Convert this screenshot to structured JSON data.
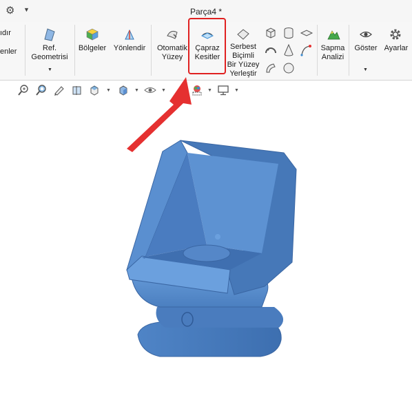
{
  "window": {
    "title": "Parça4 *",
    "settings_icon": "gear-icon"
  },
  "ribbon": {
    "left_cut_1": "ıdır",
    "left_cut_2": "enler",
    "ref_geometry": {
      "line1": "Ref.",
      "line2": "Geometrisi"
    },
    "regions": "Bölgeler",
    "orient": "Yönlendir",
    "auto_surface": {
      "line1": "Otomatik",
      "line2": "Yüzey"
    },
    "cross_sections": {
      "line1": "Çapraz",
      "line2": "Kesitler"
    },
    "freeform": {
      "line1": "Serbest",
      "line2": "Biçimli",
      "line3": "Bir Yüzey",
      "line4": "Yerleştir"
    },
    "deviation": {
      "line1": "Sapma",
      "line2": "Analizi"
    },
    "show": "Göster",
    "settings": "Ayarlar"
  },
  "colors": {
    "highlight": "#e02020",
    "arrow": "#e53030",
    "model": "#5b8fd0"
  }
}
